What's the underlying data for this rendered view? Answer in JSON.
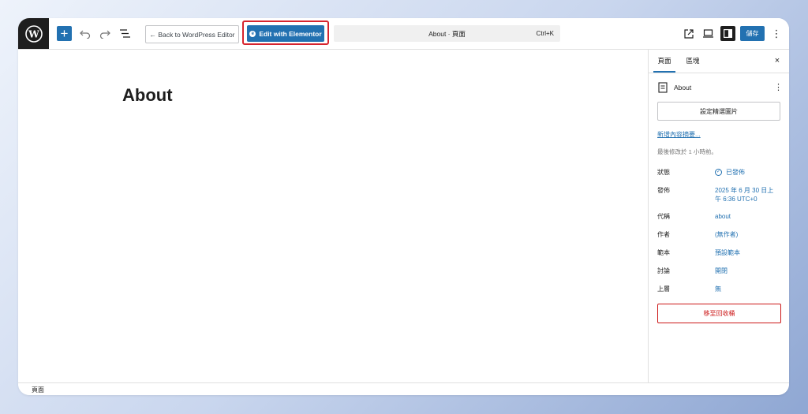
{
  "toolbar": {
    "add_label": "+",
    "back_label": "← Back to WordPress Editor",
    "elementor_label": "Edit with Elementor",
    "command_title": "About · 頁面",
    "command_shortcut": "Ctrl+K",
    "save_label": "儲存",
    "accent": "#2271b1",
    "highlight": "#d6242e"
  },
  "canvas": {
    "title": "About"
  },
  "sidebar": {
    "tabs": [
      {
        "label": "頁面"
      },
      {
        "label": "區塊"
      }
    ],
    "close_label": "×",
    "doc_title": "About",
    "featured_image_label": "設定精選圖片",
    "excerpt_link": "新增內容摘要...",
    "last_edited": "最後修改於 1 小時前。",
    "meta": [
      {
        "key": "狀態",
        "value": "已發佈"
      },
      {
        "key": "發佈",
        "value": "2025 年 6 月 30 日上午 6:36 UTC+0"
      },
      {
        "key": "代稱",
        "value": "about"
      },
      {
        "key": "作者",
        "value": "(無作者)"
      },
      {
        "key": "範本",
        "value": "預設範本"
      },
      {
        "key": "討論",
        "value": "開閉"
      },
      {
        "key": "上層",
        "value": "無"
      }
    ],
    "trash_label": "移至回收桶"
  },
  "footer": {
    "breadcrumb": "頁面"
  }
}
